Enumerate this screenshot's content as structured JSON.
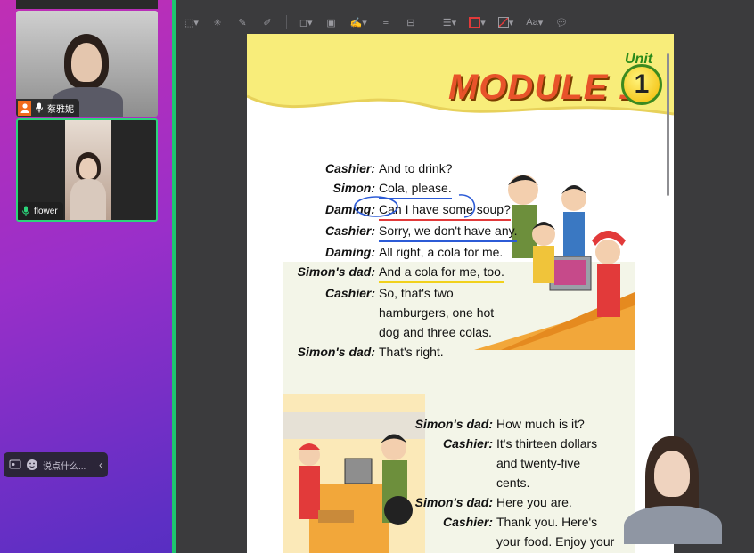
{
  "participants": [
    {
      "name": "蔡雅妮",
      "role_badge": "host"
    },
    {
      "name": "flower"
    }
  ],
  "chat": {
    "placeholder": "说点什么..."
  },
  "document": {
    "module_title": "MODULE 1",
    "unit_label": "Unit",
    "unit_number": "1",
    "dialogue_1": [
      {
        "speaker": "Cashier:",
        "line": "And to drink?"
      },
      {
        "speaker": "Simon:",
        "line": "Cola, please."
      },
      {
        "speaker": "Daming:",
        "line": "Can I have some soup?"
      },
      {
        "speaker": "Cashier:",
        "line": "Sorry, we don't have any."
      },
      {
        "speaker": "Daming:",
        "line": "All right, a cola for me."
      },
      {
        "speaker": "Simon's dad:",
        "line": "And a cola for me, too."
      },
      {
        "speaker": "Cashier:",
        "line": "So, that's two hamburgers, one hot dog and three colas."
      },
      {
        "speaker": "Simon's dad:",
        "line": "That's right."
      }
    ],
    "dialogue_2": [
      {
        "speaker": "Simon's dad:",
        "line": "How much is it?"
      },
      {
        "speaker": "Cashier:",
        "line": "It's thirteen dollars and twenty-five cents."
      },
      {
        "speaker": "Simon's dad:",
        "line": "Here you are."
      },
      {
        "speaker": "Cashier:",
        "line": "Thank you. Here's your food. Enjoy your meal!"
      }
    ]
  },
  "toolbar": {
    "text_tool_label": "Aa"
  },
  "colors": {
    "accent_green": "#1ec46e",
    "banner_yellow": "#f8ed7a",
    "annotation_red": "#e23a3a",
    "annotation_blue": "#2c5bd6",
    "annotation_yellow": "#f1d11c"
  }
}
